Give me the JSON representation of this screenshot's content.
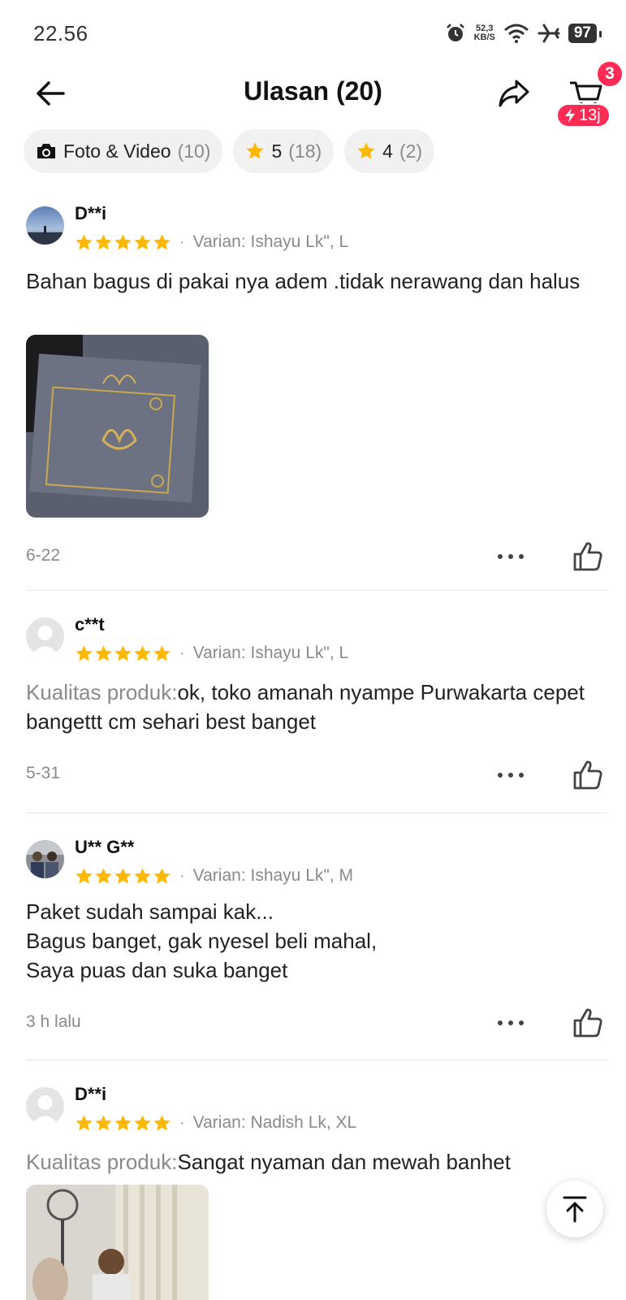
{
  "status_bar": {
    "time": "22.56",
    "net_speed_value": "52,3",
    "net_speed_unit": "KB/S",
    "battery": "97"
  },
  "header": {
    "title": "Ulasan (20)",
    "cart_count": "3",
    "flash_label": "13j"
  },
  "filters": [
    {
      "label": "Foto & Video",
      "count": "(10)",
      "icon": "camera-icon"
    },
    {
      "label": "5",
      "count": "(18)",
      "icon": "star-icon"
    },
    {
      "label": "4",
      "count": "(2)",
      "icon": "star-icon"
    }
  ],
  "colors": {
    "star": "#FFB800",
    "accent": "#FE2C55",
    "muted": "#8A8A8A"
  },
  "reviews": [
    {
      "user": "D**i",
      "rating": 5,
      "variant": "Varian: Ishayu Lk\", L",
      "label": "",
      "text": "Bahan bagus di pakai nya adem .tidak nerawang dan halus",
      "date": "6-22",
      "photo": "product-package-photo"
    },
    {
      "user": "c**t",
      "rating": 5,
      "variant": "Varian: Ishayu Lk\", L",
      "label": "Kualitas produk:",
      "text": "ok, toko amanah nyampe Purwakarta cepet bangettt cm sehari best banget",
      "date": "5-31"
    },
    {
      "user": "U** G**",
      "rating": 5,
      "variant": "Varian: Ishayu Lk\", M",
      "label": "",
      "text_lines": [
        "Paket sudah sampai kak...",
        "Bagus banget, gak nyesel beli mahal,",
        "Saya puas dan suka banget"
      ],
      "date": "3 h lalu"
    },
    {
      "user": "D**i",
      "rating": 5,
      "variant": "Varian: Nadish Lk, XL",
      "label": "Kualitas produk:",
      "text": "Sangat nyaman dan mewah banhet",
      "photo": "customer-photo"
    }
  ]
}
